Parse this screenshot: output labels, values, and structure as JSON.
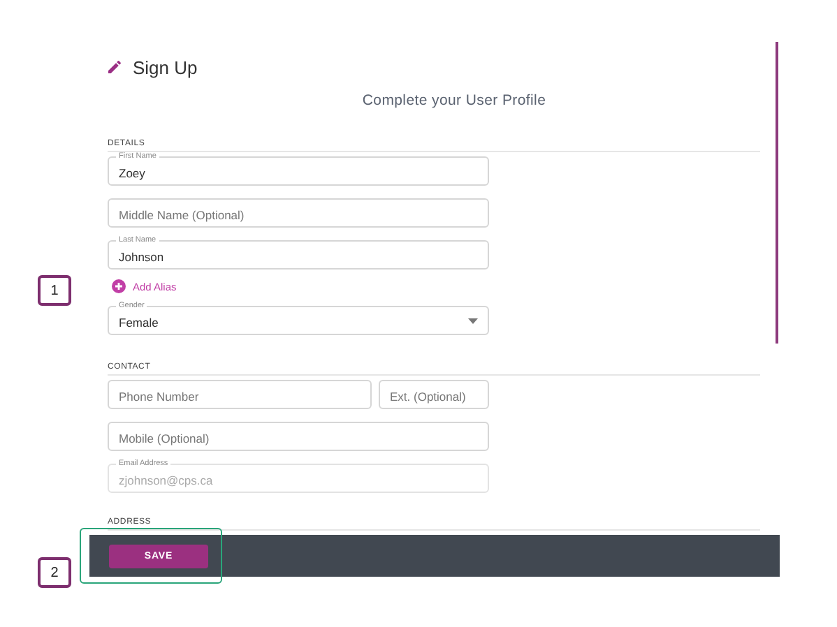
{
  "header": {
    "title": "Sign Up",
    "subtitle": "Complete your User Profile"
  },
  "sections": [
    {
      "heading": "DETAILS",
      "rows": [
        [
          {
            "kind": "text",
            "label": "First Name",
            "value": "Zoey",
            "disabled": false
          }
        ],
        [
          {
            "kind": "text",
            "placeholder": "Middle Name (Optional)",
            "disabled": false
          }
        ],
        [
          {
            "kind": "text",
            "label": "Last Name",
            "value": "Johnson",
            "disabled": false
          }
        ],
        [
          {
            "kind": "link",
            "text": "Add Alias"
          }
        ],
        [
          {
            "kind": "select",
            "label": "Gender",
            "value": "Female",
            "disabled": false
          }
        ]
      ]
    },
    {
      "heading": "CONTACT",
      "rows": [
        [
          {
            "kind": "text",
            "placeholder": "Phone Number",
            "disabled": false
          },
          {
            "kind": "text",
            "placeholder": "Ext. (Optional)",
            "disabled": false
          }
        ],
        [
          {
            "kind": "text",
            "placeholder": "Mobile (Optional)",
            "disabled": false
          }
        ],
        [
          {
            "kind": "text",
            "label": "Email Address",
            "value": "zjohnson@cps.ca",
            "disabled": true
          }
        ]
      ]
    },
    {
      "heading": "ADDRESS"
    }
  ],
  "footer": {
    "button": "SAVE"
  },
  "callouts": [
    {
      "label": "1"
    },
    {
      "label": "2"
    }
  ]
}
